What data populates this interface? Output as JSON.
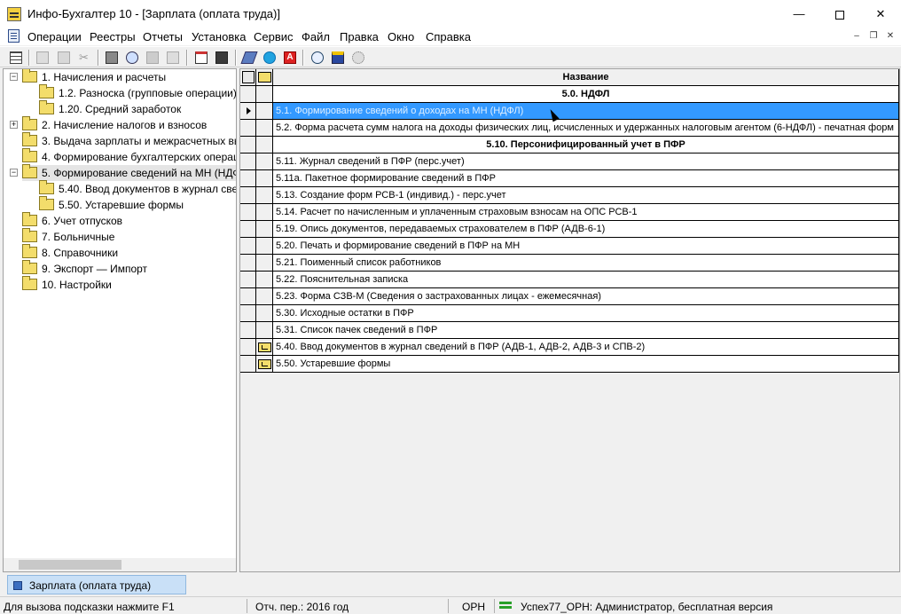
{
  "window": {
    "title": "Инфо-Бухгалтер 10 - [Зарплата (оплата труда)]",
    "minimize": "—",
    "close": "✕"
  },
  "menu": {
    "items": [
      "Операции",
      "Реестры",
      "Отчеты",
      "Установка",
      "Сервис",
      "Файл",
      "Правка",
      "Окно",
      "Справка"
    ],
    "mdi": {
      "minimize": "–",
      "restore": "❐",
      "close": "✕"
    }
  },
  "toolbar": {
    "buttons": [
      "grid-view-icon",
      "copy-icon",
      "paste-icon",
      "cut-icon",
      "print-icon",
      "preview-icon",
      "image-icon",
      "calc-sheet-icon",
      "calendar-icon",
      "calculator-icon",
      "eraser-icon",
      "skype-icon",
      "font-a-icon",
      "compass-icon",
      "photo-icon",
      "settings-icon"
    ]
  },
  "tree": {
    "items": [
      {
        "label": "1. Начисления и расчеты",
        "expander": "−"
      },
      {
        "label": "1.2. Разноска (групповые операции)"
      },
      {
        "label": "1.20. Средний заработок"
      },
      {
        "label": "2. Начисление налогов и взносов",
        "expander": "+"
      },
      {
        "label": "3. Выдача зарплаты и межрасчетных вы"
      },
      {
        "label": "4. Формирование бухгалтерских операц"
      },
      {
        "label": "5. Формирование сведений на МН (НДФ",
        "expander": "−"
      },
      {
        "label": "5.40. Ввод документов в журнал свед"
      },
      {
        "label": "5.50. Устаревшие формы"
      },
      {
        "label": "6. Учет отпусков"
      },
      {
        "label": "7. Больничные"
      },
      {
        "label": "8. Справочники"
      },
      {
        "label": "9. Экспорт — Импорт"
      },
      {
        "label": "10. Настройки"
      }
    ]
  },
  "grid": {
    "header": "Название",
    "rows": [
      {
        "text": "5.0. НДФЛ",
        "kind": "group"
      },
      {
        "text": "5.1. Формирование сведений о доходах на МН (НДФЛ)",
        "kind": "selected"
      },
      {
        "text": "5.2. Форма расчета сумм налога на доходы физических лиц, исчисленных и удержанных налоговым агентом (6-НДФЛ) - печатная форм"
      },
      {
        "text": "5.10. Персонифицированный учет в ПФР",
        "kind": "group"
      },
      {
        "text": "5.11. Журнал сведений в ПФР (перс.учет)"
      },
      {
        "text": "5.11а. Пакетное формирование сведений в ПФР"
      },
      {
        "text": "5.13. Создание форм РСВ-1 (индивид.) - перс.учет"
      },
      {
        "text": "5.14. Расчет по начисленным и уплаченным страховым взносам на ОПС РСВ-1"
      },
      {
        "text": "5.19. Опись документов, передаваемых страхователем в ПФР (АДВ-6-1)"
      },
      {
        "text": "5.20. Печать и формирование сведений в ПФР на МН"
      },
      {
        "text": "5.21. Поименный список работников"
      },
      {
        "text": "5.22. Пояснительная записка"
      },
      {
        "text": "5.23. Форма СЗВ-М (Сведения о застрахованных лицах - ежемесячная)"
      },
      {
        "text": "5.30. Исходные остатки в ПФР"
      },
      {
        "text": "5.31. Список пачек сведений в ПФР"
      },
      {
        "text": "5.40. Ввод документов в журнал сведений в ПФР (АДВ-1, АДВ-2, АДВ-3 и СПВ-2)",
        "kind": "folder"
      },
      {
        "text": "5.50. Устаревшие формы",
        "kind": "folder"
      }
    ]
  },
  "tab": {
    "label": "Зарплата (оплата труда)"
  },
  "status": {
    "hint": "Для вызова подсказки нажмите F1",
    "period": "Отч. пер.: 2016 год",
    "org": "ОРН",
    "user": "Успех77_ОРН: Администратор, бесплатная версия"
  },
  "colors": {
    "selection": "#3399ff",
    "folder": "#f3dd6b",
    "tab": "#c9e0f7"
  }
}
